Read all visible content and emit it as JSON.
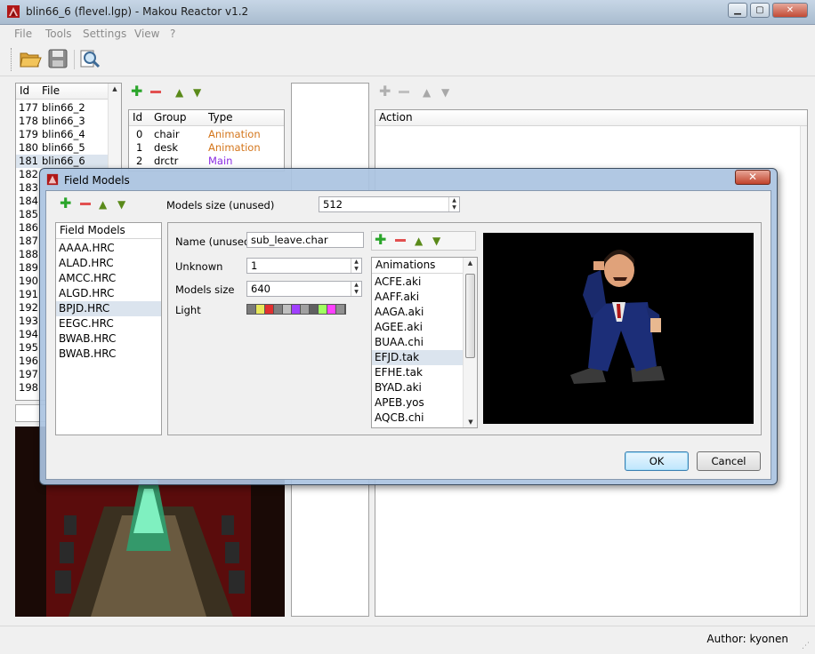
{
  "window": {
    "title": "blin66_6 (flevel.lgp) - Makou Reactor v1.2"
  },
  "menu": [
    "File",
    "Tools",
    "Settings",
    "View",
    "?"
  ],
  "toolbar": {
    "icons": [
      "open-folder-icon",
      "save-icon",
      "search-icon"
    ]
  },
  "file_list": {
    "headers": {
      "id": "Id",
      "file": "File"
    },
    "rows": [
      {
        "id": "177",
        "file": "blin66_2"
      },
      {
        "id": "178",
        "file": "blin66_3"
      },
      {
        "id": "179",
        "file": "blin66_4"
      },
      {
        "id": "180",
        "file": "blin66_5"
      },
      {
        "id": "181",
        "file": "blin66_6"
      },
      {
        "id": "182",
        "file": ""
      },
      {
        "id": "183",
        "file": ""
      },
      {
        "id": "184",
        "file": ""
      },
      {
        "id": "185",
        "file": ""
      },
      {
        "id": "186",
        "file": ""
      },
      {
        "id": "187",
        "file": ""
      },
      {
        "id": "188",
        "file": ""
      },
      {
        "id": "189",
        "file": ""
      },
      {
        "id": "190",
        "file": ""
      },
      {
        "id": "191",
        "file": ""
      },
      {
        "id": "192",
        "file": ""
      },
      {
        "id": "193",
        "file": ""
      },
      {
        "id": "194",
        "file": ""
      },
      {
        "id": "195",
        "file": ""
      },
      {
        "id": "196",
        "file": ""
      },
      {
        "id": "197",
        "file": ""
      },
      {
        "id": "198",
        "file": ""
      }
    ]
  },
  "groups": {
    "headers": {
      "id": "Id",
      "group": "Group",
      "type": "Type"
    },
    "rows": [
      {
        "id": "0",
        "group": "chair",
        "type": "Animation",
        "color": "#d4761c"
      },
      {
        "id": "1",
        "group": "desk",
        "type": "Animation",
        "color": "#d4761c"
      },
      {
        "id": "2",
        "group": "drctr",
        "type": "Main",
        "color": "#8a2be2"
      }
    ]
  },
  "actions": {
    "header": "Action"
  },
  "status": {
    "author": "Author: kyonen"
  },
  "dialog": {
    "title": "Field Models",
    "close_symbol": "✕",
    "models_size_unused_label": "Models size (unused)",
    "models_size_unused_value": "512",
    "field_models_header": "Field Models",
    "field_models": [
      "AAAA.HRC",
      "ALAD.HRC",
      "AMCC.HRC",
      "ALGD.HRC",
      "BPJD.HRC",
      "EEGC.HRC",
      "BWAB.HRC",
      "BWAB.HRC"
    ],
    "selected_model_index": 4,
    "name_label": "Name (unused)",
    "name_value": "sub_leave.char",
    "unknown_label": "Unknown",
    "unknown_value": "1",
    "models_size_label": "Models size",
    "models_size_value": "640",
    "light_label": "Light",
    "light_colors": [
      "#7a7a7a",
      "#e8e85a",
      "#e03030",
      "#808080",
      "#c0c0c0",
      "#a040ff",
      "#a0a0a0",
      "#606060",
      "#a0ff60",
      "#ff40ff",
      "#909090"
    ],
    "animations_header": "Animations",
    "animations": [
      "ACFE.aki",
      "AAFF.aki",
      "AAGA.aki",
      "AGEE.aki",
      "BUAA.chi",
      "EFJD.tak",
      "EFHE.tak",
      "BYAD.aki",
      "APEB.yos",
      "AQCB.chi"
    ],
    "selected_animation_index": 5,
    "ok_label": "OK",
    "cancel_label": "Cancel"
  }
}
